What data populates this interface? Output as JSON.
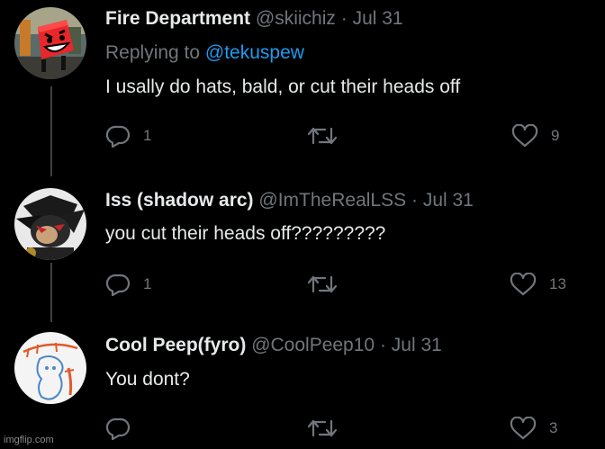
{
  "tweets": [
    {
      "name": "Fire Department",
      "handle": "@skiichiz",
      "separator": "·",
      "date": "Jul 31",
      "replying_prefix": "Replying to",
      "replying_to": "@tekuspew",
      "text": "I usally do hats, bald, or cut their heads off",
      "replies": "1",
      "retweets": "",
      "likes": "9",
      "avatar_icon": "red-cube-character-avatar"
    },
    {
      "name": "Iss (shadow arc)",
      "handle": "@ImTheRealLSS",
      "separator": "·",
      "date": "Jul 31",
      "text": "you cut their heads off?????????",
      "replies": "1",
      "retweets": "",
      "likes": "13",
      "avatar_icon": "dark-hedgehog-avatar"
    },
    {
      "name": "Cool Peep(fyro)",
      "handle": "@CoolPeep10",
      "separator": "·",
      "date": "Jul 31",
      "text": "You dont?",
      "replies": "",
      "retweets": "",
      "likes": "3",
      "avatar_icon": "doodle-character-avatar"
    }
  ],
  "icons": {
    "reply": "reply-icon",
    "retweet": "retweet-icon",
    "like": "heart-icon"
  },
  "colors": {
    "background": "#000000",
    "text": "#e7e9ea",
    "muted": "#71767b",
    "link": "#1d9bf0",
    "thread_line": "#3e4144"
  },
  "watermark": "imgflip.com"
}
